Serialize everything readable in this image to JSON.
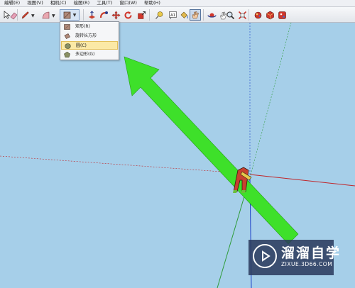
{
  "menu": [
    "编辑(E)",
    "视图(V)",
    "相机(C)",
    "绘图(R)",
    "工具(T)",
    "窗口(W)",
    "帮助(H)"
  ],
  "toolbar": {
    "tools": [
      "select-icon",
      "eraser-icon",
      "pencil-icon",
      "arc-icon",
      "rectangle-icon",
      "push-pull-icon",
      "follow-me-icon",
      "move-icon",
      "rotate-icon",
      "scale-icon",
      "tape-measure-icon",
      "text-icon",
      "paint-bucket-icon",
      "orbit-icon",
      "pan-icon",
      "zoom-icon",
      "zoom-extents-icon",
      "components-icon",
      "materials-icon",
      "styles-icon"
    ],
    "active_tool": "rectangle-icon"
  },
  "shape_menu": {
    "items": [
      {
        "label": "矩形(R)",
        "icon": "rectangle-icon"
      },
      {
        "label": "旋转长方形",
        "icon": "rotated-rectangle-icon"
      },
      {
        "label": "圆(C)",
        "icon": "circle-icon",
        "highlighted": true
      },
      {
        "label": "多边形(G)",
        "icon": "polygon-icon"
      }
    ]
  },
  "watermark": {
    "title": "溜溜自学",
    "url": "ZIXUE.3D66.COM"
  },
  "colors": {
    "canvas": "#a6cfe9",
    "arrow": "#3ee02a",
    "axis_red": "#c0262a",
    "axis_green": "#2f9c3a",
    "axis_blue": "#1c3fc8",
    "highlight": "#fbe9a6"
  }
}
